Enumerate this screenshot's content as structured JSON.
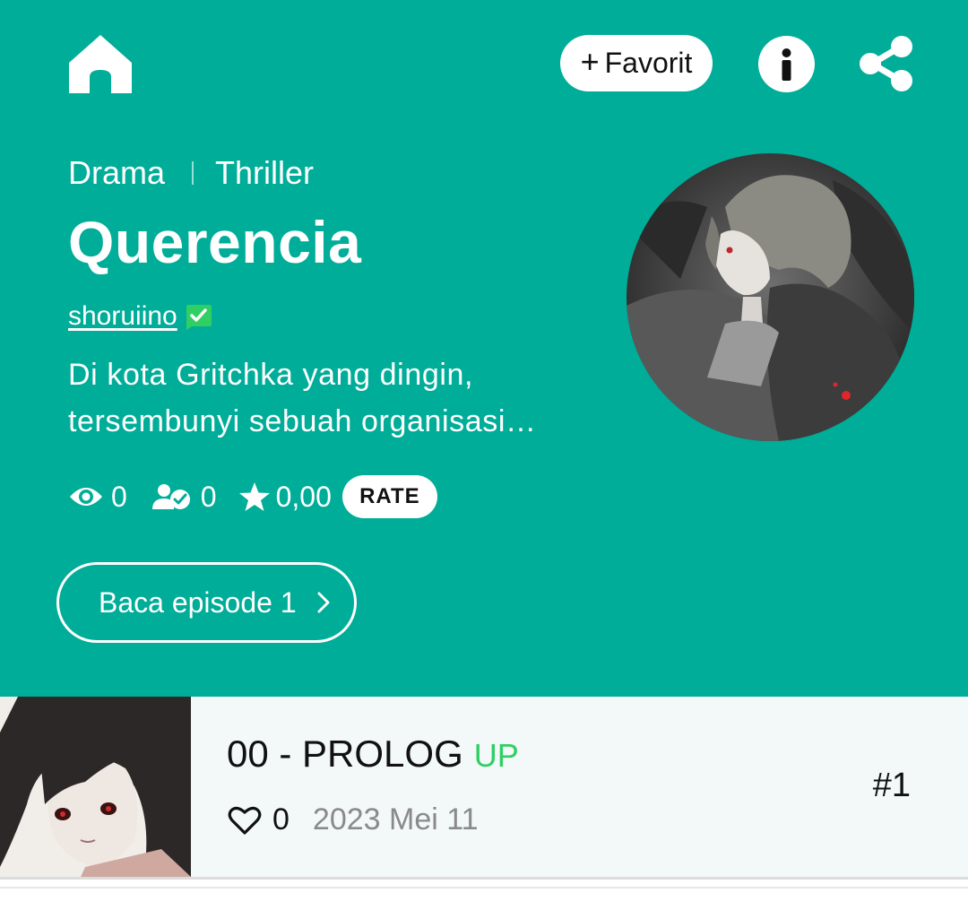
{
  "header": {
    "home_icon": "home-icon",
    "favorite_label": "Favorit",
    "favorite_plus": "+",
    "info_icon": "info-icon",
    "share_icon": "share-icon"
  },
  "series": {
    "genres": [
      "Drama",
      "Thriller"
    ],
    "title": "Querencia",
    "author": "shoruiino",
    "description": "Di kota Gritchka yang dingin, tersembunyi sebuah organisasi…",
    "stats": {
      "views": "0",
      "subscribers": "0",
      "rating": "0,00",
      "rate_label": "RATE"
    },
    "read_button": "Baca episode 1"
  },
  "episodes": [
    {
      "title": "00 - PROLOG",
      "badge": "UP",
      "likes": "0",
      "date": "2023 Mei 11",
      "number": "#1"
    }
  ],
  "colors": {
    "accent": "#00ad98",
    "up_badge": "#2fcf63",
    "verified": "#2fcf63"
  }
}
